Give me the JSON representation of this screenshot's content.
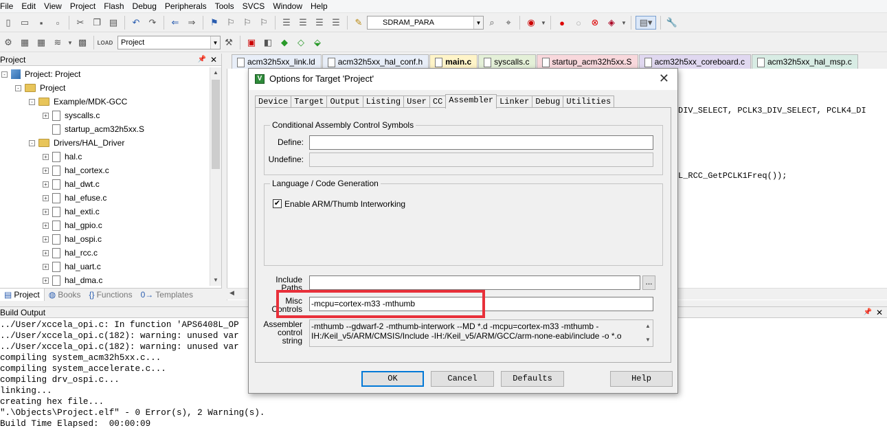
{
  "menu": [
    "File",
    "Edit",
    "View",
    "Project",
    "Flash",
    "Debug",
    "Peripherals",
    "Tools",
    "SVCS",
    "Window",
    "Help"
  ],
  "toolbar1": {
    "target_combo": "SDRAM_PARA"
  },
  "toolbar2": {
    "project_combo": "Project"
  },
  "project_panel": {
    "title": "Project",
    "tree": [
      {
        "label": "Project: Project",
        "level": 0,
        "type": "proj",
        "exp": "-"
      },
      {
        "label": "Project",
        "level": 1,
        "type": "folder",
        "exp": "-"
      },
      {
        "label": "Example/MDK-GCC",
        "level": 2,
        "type": "folder",
        "exp": "-"
      },
      {
        "label": "syscalls.c",
        "level": 3,
        "type": "file",
        "exp": "+"
      },
      {
        "label": "startup_acm32h5xx.S",
        "level": 3,
        "type": "file",
        "exp": ""
      },
      {
        "label": "Drivers/HAL_Driver",
        "level": 2,
        "type": "folder",
        "exp": "-"
      },
      {
        "label": "hal.c",
        "level": 3,
        "type": "file",
        "exp": "+"
      },
      {
        "label": "hal_cortex.c",
        "level": 3,
        "type": "file",
        "exp": "+"
      },
      {
        "label": "hal_dwt.c",
        "level": 3,
        "type": "file",
        "exp": "+"
      },
      {
        "label": "hal_efuse.c",
        "level": 3,
        "type": "file",
        "exp": "+"
      },
      {
        "label": "hal_exti.c",
        "level": 3,
        "type": "file",
        "exp": "+"
      },
      {
        "label": "hal_gpio.c",
        "level": 3,
        "type": "file",
        "exp": "+"
      },
      {
        "label": "hal_ospi.c",
        "level": 3,
        "type": "file",
        "exp": "+"
      },
      {
        "label": "hal_rcc.c",
        "level": 3,
        "type": "file",
        "exp": "+"
      },
      {
        "label": "hal_uart.c",
        "level": 3,
        "type": "file",
        "exp": "+"
      },
      {
        "label": "hal_dma.c",
        "level": 3,
        "type": "file",
        "exp": "+"
      }
    ],
    "tabs": [
      "Project",
      "Books",
      "Functions",
      "Templates"
    ],
    "tab_glyphs": [
      "▤",
      "◍",
      "{}",
      "0→"
    ]
  },
  "editor": {
    "tabs": [
      {
        "label": "acm32h5xx_link.ld",
        "color": "#e8eef8"
      },
      {
        "label": "acm32h5xx_hal_conf.h",
        "color": "#e8eef8"
      },
      {
        "label": "main.c",
        "color": "#fff4c8",
        "active": true
      },
      {
        "label": "syscalls.c",
        "color": "#e4f0d8"
      },
      {
        "label": "startup_acm32h5xx.S",
        "color": "#f8d8dc"
      },
      {
        "label": "acm32h5xx_coreboard.c",
        "color": "#e0d8f0"
      },
      {
        "label": "acm32h5xx_hal_msp.c",
        "color": "#d8ece4"
      }
    ],
    "code_line1": "DIV_SELECT, PCLK3_DIV_SELECT, PCLK4_DI",
    "code_line2": "L_RCC_GetPCLK1Freq());"
  },
  "build_output": {
    "title": "Build Output",
    "lines": [
      "../User/xccela_opi.c: In function 'APS6408L_OP",
      "../User/xccela_opi.c(182): warning: unused var",
      "../User/xccela_opi.c(182): warning: unused var",
      "compiling system_acm32h5xx.c...",
      "compiling system_accelerate.c...",
      "compiling drv_ospi.c...",
      "linking...",
      "creating hex file...",
      "\".\\Objects\\Project.elf\" - 0 Error(s), 2 Warning(s).",
      "Build Time Elapsed:  00:00:09"
    ]
  },
  "dialog": {
    "title": "Options for Target 'Project'",
    "tabs": [
      "Device",
      "Target",
      "Output",
      "Listing",
      "User",
      "CC",
      "Assembler",
      "Linker",
      "Debug",
      "Utilities"
    ],
    "active_tab": "Assembler",
    "group1_label": "Conditional Assembly Control Symbols",
    "define_label": "Define:",
    "define_value": "",
    "undefine_label": "Undefine:",
    "undefine_value": "",
    "group2_label": "Language / Code Generation",
    "interwork_label": "Enable ARM/Thumb Interworking",
    "interwork_checked": "✔",
    "include_label": "Include Paths",
    "include_value": "",
    "browse_label": "...",
    "misc_label": "Misc Controls",
    "misc_value": "-mcpu=cortex-m33 -mthumb",
    "ctrlstr_label": "Assembler control string",
    "ctrlstr_value": "-mthumb --gdwarf-2 -mthumb-interwork --MD *.d -mcpu=cortex-m33 -mthumb -IH:/Keil_v5/ARM/CMSIS/Include -IH:/Keil_v5/ARM/GCC/arm-none-eabi/include -o *.o",
    "buttons": {
      "ok": "OK",
      "cancel": "Cancel",
      "defaults": "Defaults",
      "help": "Help"
    },
    "highlight_color": "#e8303a"
  }
}
